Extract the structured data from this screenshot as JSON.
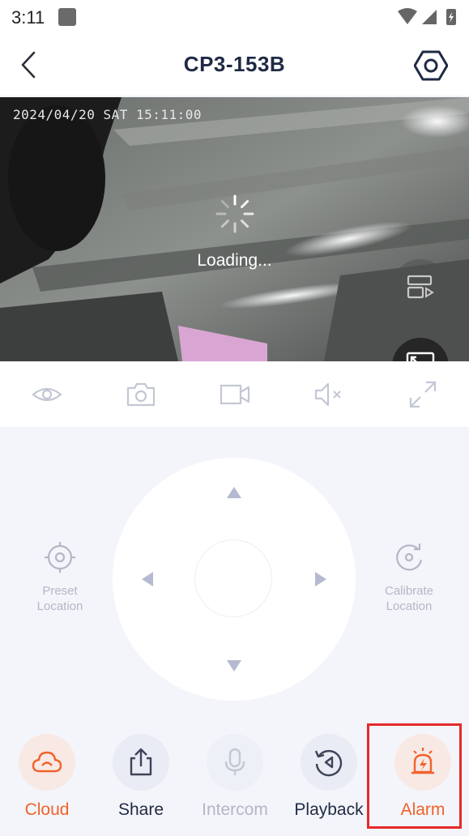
{
  "status_bar": {
    "time": "3:11"
  },
  "header": {
    "title": "CP3-153B"
  },
  "video": {
    "timestamp": "2024/04/20 SAT 15:11:00",
    "loading_text": "Loading..."
  },
  "controls": {
    "preset_label": "Preset\nLocation",
    "calibrate_label": "Calibrate\nLocation"
  },
  "bottom_actions": {
    "cloud": "Cloud",
    "share": "Share",
    "intercom": "Intercom",
    "playback": "Playback",
    "alarm": "Alarm"
  },
  "colors": {
    "accent_orange": "#f0622a",
    "title_navy": "#1f2a44",
    "disabled_gray": "#b3b7c6",
    "highlight_red": "#e52a2a"
  }
}
